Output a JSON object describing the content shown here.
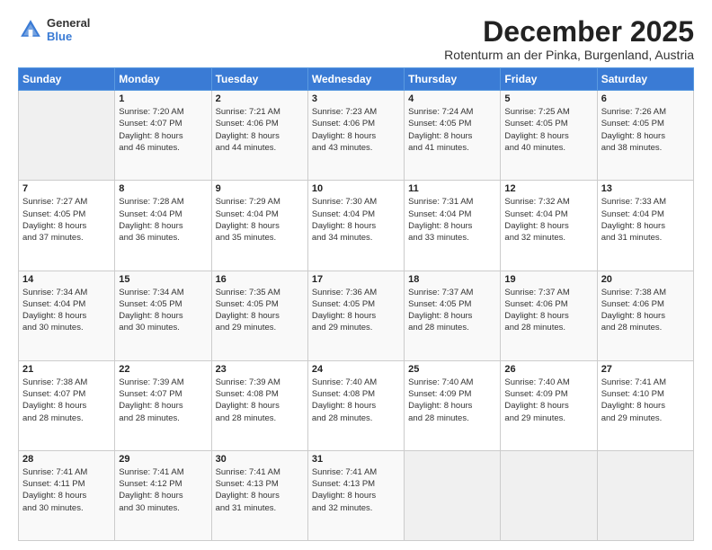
{
  "header": {
    "logo_general": "General",
    "logo_blue": "Blue",
    "month_title": "December 2025",
    "subtitle": "Rotenturm an der Pinka, Burgenland, Austria"
  },
  "calendar": {
    "headers": [
      "Sunday",
      "Monday",
      "Tuesday",
      "Wednesday",
      "Thursday",
      "Friday",
      "Saturday"
    ],
    "rows": [
      [
        {
          "day": "",
          "info": ""
        },
        {
          "day": "1",
          "info": "Sunrise: 7:20 AM\nSunset: 4:07 PM\nDaylight: 8 hours\nand 46 minutes."
        },
        {
          "day": "2",
          "info": "Sunrise: 7:21 AM\nSunset: 4:06 PM\nDaylight: 8 hours\nand 44 minutes."
        },
        {
          "day": "3",
          "info": "Sunrise: 7:23 AM\nSunset: 4:06 PM\nDaylight: 8 hours\nand 43 minutes."
        },
        {
          "day": "4",
          "info": "Sunrise: 7:24 AM\nSunset: 4:05 PM\nDaylight: 8 hours\nand 41 minutes."
        },
        {
          "day": "5",
          "info": "Sunrise: 7:25 AM\nSunset: 4:05 PM\nDaylight: 8 hours\nand 40 minutes."
        },
        {
          "day": "6",
          "info": "Sunrise: 7:26 AM\nSunset: 4:05 PM\nDaylight: 8 hours\nand 38 minutes."
        }
      ],
      [
        {
          "day": "7",
          "info": "Sunrise: 7:27 AM\nSunset: 4:05 PM\nDaylight: 8 hours\nand 37 minutes."
        },
        {
          "day": "8",
          "info": "Sunrise: 7:28 AM\nSunset: 4:04 PM\nDaylight: 8 hours\nand 36 minutes."
        },
        {
          "day": "9",
          "info": "Sunrise: 7:29 AM\nSunset: 4:04 PM\nDaylight: 8 hours\nand 35 minutes."
        },
        {
          "day": "10",
          "info": "Sunrise: 7:30 AM\nSunset: 4:04 PM\nDaylight: 8 hours\nand 34 minutes."
        },
        {
          "day": "11",
          "info": "Sunrise: 7:31 AM\nSunset: 4:04 PM\nDaylight: 8 hours\nand 33 minutes."
        },
        {
          "day": "12",
          "info": "Sunrise: 7:32 AM\nSunset: 4:04 PM\nDaylight: 8 hours\nand 32 minutes."
        },
        {
          "day": "13",
          "info": "Sunrise: 7:33 AM\nSunset: 4:04 PM\nDaylight: 8 hours\nand 31 minutes."
        }
      ],
      [
        {
          "day": "14",
          "info": "Sunrise: 7:34 AM\nSunset: 4:04 PM\nDaylight: 8 hours\nand 30 minutes."
        },
        {
          "day": "15",
          "info": "Sunrise: 7:34 AM\nSunset: 4:05 PM\nDaylight: 8 hours\nand 30 minutes."
        },
        {
          "day": "16",
          "info": "Sunrise: 7:35 AM\nSunset: 4:05 PM\nDaylight: 8 hours\nand 29 minutes."
        },
        {
          "day": "17",
          "info": "Sunrise: 7:36 AM\nSunset: 4:05 PM\nDaylight: 8 hours\nand 29 minutes."
        },
        {
          "day": "18",
          "info": "Sunrise: 7:37 AM\nSunset: 4:05 PM\nDaylight: 8 hours\nand 28 minutes."
        },
        {
          "day": "19",
          "info": "Sunrise: 7:37 AM\nSunset: 4:06 PM\nDaylight: 8 hours\nand 28 minutes."
        },
        {
          "day": "20",
          "info": "Sunrise: 7:38 AM\nSunset: 4:06 PM\nDaylight: 8 hours\nand 28 minutes."
        }
      ],
      [
        {
          "day": "21",
          "info": "Sunrise: 7:38 AM\nSunset: 4:07 PM\nDaylight: 8 hours\nand 28 minutes."
        },
        {
          "day": "22",
          "info": "Sunrise: 7:39 AM\nSunset: 4:07 PM\nDaylight: 8 hours\nand 28 minutes."
        },
        {
          "day": "23",
          "info": "Sunrise: 7:39 AM\nSunset: 4:08 PM\nDaylight: 8 hours\nand 28 minutes."
        },
        {
          "day": "24",
          "info": "Sunrise: 7:40 AM\nSunset: 4:08 PM\nDaylight: 8 hours\nand 28 minutes."
        },
        {
          "day": "25",
          "info": "Sunrise: 7:40 AM\nSunset: 4:09 PM\nDaylight: 8 hours\nand 28 minutes."
        },
        {
          "day": "26",
          "info": "Sunrise: 7:40 AM\nSunset: 4:09 PM\nDaylight: 8 hours\nand 29 minutes."
        },
        {
          "day": "27",
          "info": "Sunrise: 7:41 AM\nSunset: 4:10 PM\nDaylight: 8 hours\nand 29 minutes."
        }
      ],
      [
        {
          "day": "28",
          "info": "Sunrise: 7:41 AM\nSunset: 4:11 PM\nDaylight: 8 hours\nand 30 minutes."
        },
        {
          "day": "29",
          "info": "Sunrise: 7:41 AM\nSunset: 4:12 PM\nDaylight: 8 hours\nand 30 minutes."
        },
        {
          "day": "30",
          "info": "Sunrise: 7:41 AM\nSunset: 4:13 PM\nDaylight: 8 hours\nand 31 minutes."
        },
        {
          "day": "31",
          "info": "Sunrise: 7:41 AM\nSunset: 4:13 PM\nDaylight: 8 hours\nand 32 minutes."
        },
        {
          "day": "",
          "info": ""
        },
        {
          "day": "",
          "info": ""
        },
        {
          "day": "",
          "info": ""
        }
      ]
    ]
  }
}
